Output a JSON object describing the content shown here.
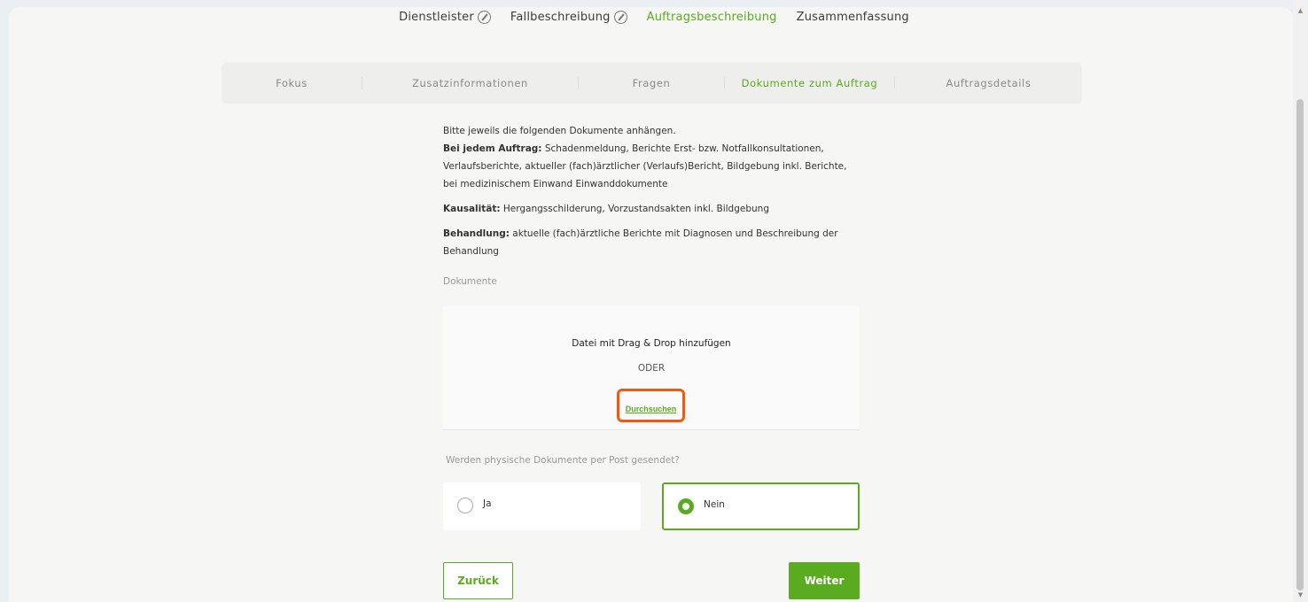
{
  "steps": [
    {
      "label": "Dienstleister",
      "state": "done"
    },
    {
      "label": "Fallbeschreibung",
      "state": "done"
    },
    {
      "label": "Auftragsbeschreibung",
      "state": "active"
    },
    {
      "label": "Zusammenfassung",
      "state": "pending"
    }
  ],
  "tabs": [
    {
      "label": "Fokus"
    },
    {
      "label": "Zusatzinformationen"
    },
    {
      "label": "Fragen"
    },
    {
      "label": "Dokumente zum Auftrag",
      "active": true
    },
    {
      "label": "Auftragsdetails"
    }
  ],
  "instructions": {
    "intro": "Bitte jeweils die folgenden Dokumente anhängen.",
    "every_order_label": "Bei jedem Auftrag:",
    "every_order_text": " Schadenmeldung, Berichte Erst- bzw. Notfallkonsultationen, Verlaufsberichte, aktueller (fach)ärztlicher (Verlaufs)Bericht, Bildgebung inkl. Berichte, bei medizinischem Einwand Einwanddokumente",
    "causality_label": "Kausalität:",
    "causality_text": " Hergangsschilderung, Vorzustandsakten inkl. Bildgebung",
    "treatment_label": "Behandlung:",
    "treatment_text": " aktuelle (fach)ärztliche Berichte mit Diagnosen und Beschreibung der Behandlung"
  },
  "documents": {
    "label": "Dokumente",
    "dropzone_title": "Datei mit Drag & Drop hinzufügen",
    "or_text": "ODER",
    "browse_label": "Durchsuchen"
  },
  "physical_question": {
    "label": "Werden physische Dokumente per Post gesendet?",
    "options": [
      {
        "label": "Ja",
        "selected": false
      },
      {
        "label": "Nein",
        "selected": true
      }
    ]
  },
  "nav": {
    "back_label": "Zurück",
    "next_label": "Weiter"
  },
  "colors": {
    "accent": "#5aab1f",
    "highlight": "#ef5a13"
  }
}
